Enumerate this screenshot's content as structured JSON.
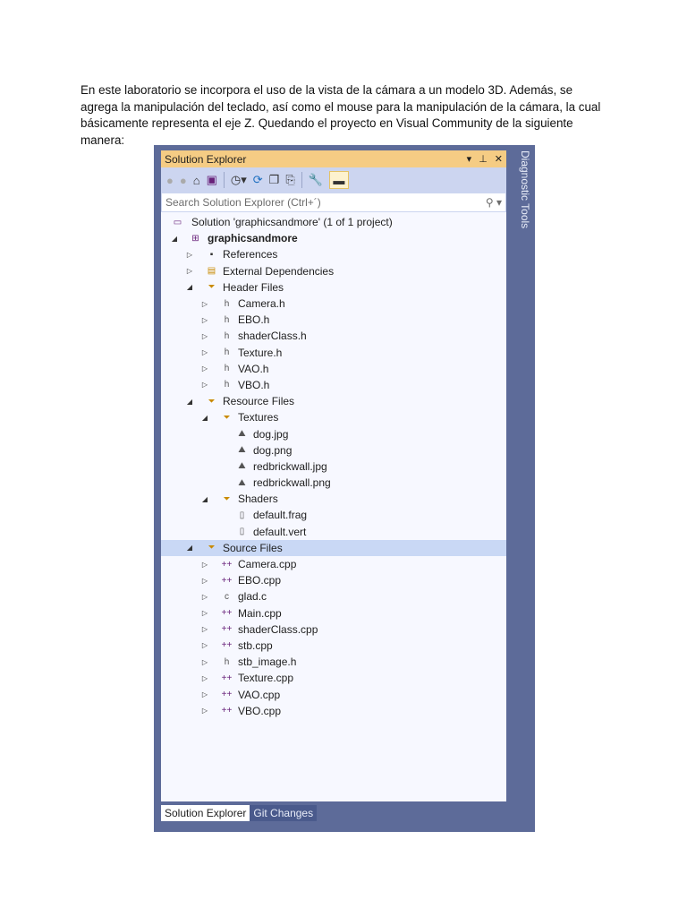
{
  "intro": "En este laboratorio se incorpora el uso de la vista de la cámara a un modelo 3D. Además, se agrega la manipulación del teclado, así como el mouse para la manipulación de la cámara, la cual básicamente representa el eje Z. Quedando el proyecto en Visual Community de la siguiente manera:",
  "panel": {
    "title": "Solution Explorer",
    "side_tab": "Diagnostic Tools",
    "search_placeholder": "Search Solution Explorer (Ctrl+´)"
  },
  "tabs": [
    "Solution Explorer",
    "Git Changes"
  ],
  "tree": [
    {
      "label": "Solution 'graphicsandmore' (1 of 1 project)",
      "depth": 0,
      "exp": "",
      "icon": "solution"
    },
    {
      "label": "graphicsandmore",
      "depth": 0,
      "exp": "open",
      "icon": "project",
      "bold": true
    },
    {
      "label": "References",
      "depth": 1,
      "exp": "closed",
      "icon": "references"
    },
    {
      "label": "External Dependencies",
      "depth": 1,
      "exp": "closed",
      "icon": "dependencies"
    },
    {
      "label": "Header Files",
      "depth": 1,
      "exp": "open",
      "icon": "filter"
    },
    {
      "label": "Camera.h",
      "depth": 2,
      "exp": "closed",
      "icon": "header"
    },
    {
      "label": "EBO.h",
      "depth": 2,
      "exp": "closed",
      "icon": "header"
    },
    {
      "label": "shaderClass.h",
      "depth": 2,
      "exp": "closed",
      "icon": "header"
    },
    {
      "label": "Texture.h",
      "depth": 2,
      "exp": "closed",
      "icon": "header"
    },
    {
      "label": "VAO.h",
      "depth": 2,
      "exp": "closed",
      "icon": "header"
    },
    {
      "label": "VBO.h",
      "depth": 2,
      "exp": "closed",
      "icon": "header"
    },
    {
      "label": "Resource Files",
      "depth": 1,
      "exp": "open",
      "icon": "filter"
    },
    {
      "label": "Textures",
      "depth": 2,
      "exp": "open",
      "icon": "filter"
    },
    {
      "label": "dog.jpg",
      "depth": 3,
      "exp": "",
      "icon": "image"
    },
    {
      "label": "dog.png",
      "depth": 3,
      "exp": "",
      "icon": "image"
    },
    {
      "label": "redbrickwall.jpg",
      "depth": 3,
      "exp": "",
      "icon": "image"
    },
    {
      "label": "redbrickwall.png",
      "depth": 3,
      "exp": "",
      "icon": "image"
    },
    {
      "label": "Shaders",
      "depth": 2,
      "exp": "open",
      "icon": "filter"
    },
    {
      "label": "default.frag",
      "depth": 3,
      "exp": "",
      "icon": "file"
    },
    {
      "label": "default.vert",
      "depth": 3,
      "exp": "",
      "icon": "file"
    },
    {
      "label": "Source Files",
      "depth": 1,
      "exp": "open",
      "icon": "filter",
      "selected": true
    },
    {
      "label": "Camera.cpp",
      "depth": 2,
      "exp": "closed",
      "icon": "cpp"
    },
    {
      "label": "EBO.cpp",
      "depth": 2,
      "exp": "closed",
      "icon": "cpp"
    },
    {
      "label": "glad.c",
      "depth": 2,
      "exp": "closed",
      "icon": "c"
    },
    {
      "label": "Main.cpp",
      "depth": 2,
      "exp": "closed",
      "icon": "cpp"
    },
    {
      "label": "shaderClass.cpp",
      "depth": 2,
      "exp": "closed",
      "icon": "cpp"
    },
    {
      "label": "stb.cpp",
      "depth": 2,
      "exp": "closed",
      "icon": "cpp"
    },
    {
      "label": "stb_image.h",
      "depth": 2,
      "exp": "closed",
      "icon": "header"
    },
    {
      "label": "Texture.cpp",
      "depth": 2,
      "exp": "closed",
      "icon": "cpp"
    },
    {
      "label": "VAO.cpp",
      "depth": 2,
      "exp": "closed",
      "icon": "cpp"
    },
    {
      "label": "VBO.cpp",
      "depth": 2,
      "exp": "closed",
      "icon": "cpp"
    }
  ]
}
